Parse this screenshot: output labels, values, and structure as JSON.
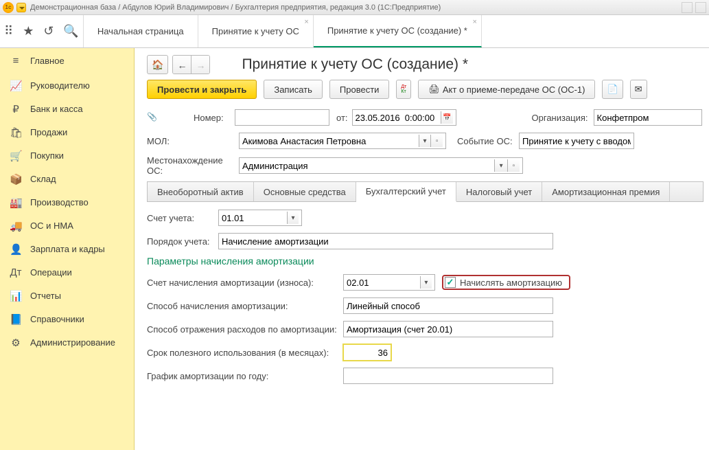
{
  "titlebar": {
    "text": "Демонстрационная база / Абдулов Юрий Владимирович / Бухгалтерия предприятия, редакция 3.0  (1С:Предприятие)"
  },
  "topTabs": {
    "home": "Начальная страница",
    "tab1": "Принятие к учету ОС",
    "tab2": "Принятие к учету ОС (создание) *"
  },
  "sidebar": {
    "items": [
      {
        "icon": "≡",
        "label": "Главное"
      },
      {
        "icon": "📈",
        "label": "Руководителю"
      },
      {
        "icon": "₽",
        "label": "Банк и касса"
      },
      {
        "icon": "🛍",
        "label": "Продажи"
      },
      {
        "icon": "🛒",
        "label": "Покупки"
      },
      {
        "icon": "📦",
        "label": "Склад"
      },
      {
        "icon": "🏭",
        "label": "Производство"
      },
      {
        "icon": "🚚",
        "label": "ОС и НМА"
      },
      {
        "icon": "👤",
        "label": "Зарплата и кадры"
      },
      {
        "icon": "Дт",
        "label": "Операции"
      },
      {
        "icon": "📊",
        "label": "Отчеты"
      },
      {
        "icon": "📘",
        "label": "Справочники"
      },
      {
        "icon": "⚙",
        "label": "Администрирование"
      }
    ]
  },
  "header": {
    "title": "Принятие к учету ОС (создание) *"
  },
  "buttons": {
    "postClose": "Провести и закрыть",
    "save": "Записать",
    "post": "Провести",
    "report": "Акт о приеме-передаче ОС (ОС-1)"
  },
  "form": {
    "numberLabel": "Номер:",
    "numberValue": "",
    "fromLabel": "от:",
    "date": "23.05.2016  0:00:00",
    "orgLabel": "Организация:",
    "org": "Конфетпром",
    "molLabel": "МОЛ:",
    "mol": "Акимова Анастасия Петровна",
    "eventLabel": "Событие ОС:",
    "event": "Принятие к учету с вводом",
    "locationLabel": "Местонахождение ОС:",
    "location": "Администрация"
  },
  "innerTabs": {
    "t1": "Внеоборотный актив",
    "t2": "Основные средства",
    "t3": "Бухгалтерский учет",
    "t4": "Налоговый учет",
    "t5": "Амортизационная премия"
  },
  "acct": {
    "accountLabel": "Счет учета:",
    "account": "01.01",
    "orderLabel": "Порядок учета:",
    "order": "Начисление амортизации",
    "section": "Параметры начисления амортизации",
    "amortAccLabel": "Счет начисления амортизации (износа):",
    "amortAcc": "02.01",
    "chargeLabel": "Начислять амортизацию",
    "methodLabel": "Способ начисления амортизации:",
    "method": "Линейный способ",
    "reflLabel": "Способ отражения расходов по амортизации:",
    "refl": "Амортизация (счет 20.01)",
    "lifeLabel": "Срок полезного использования (в месяцах):",
    "life": "36",
    "schedLabel": "График амортизации по году:"
  }
}
